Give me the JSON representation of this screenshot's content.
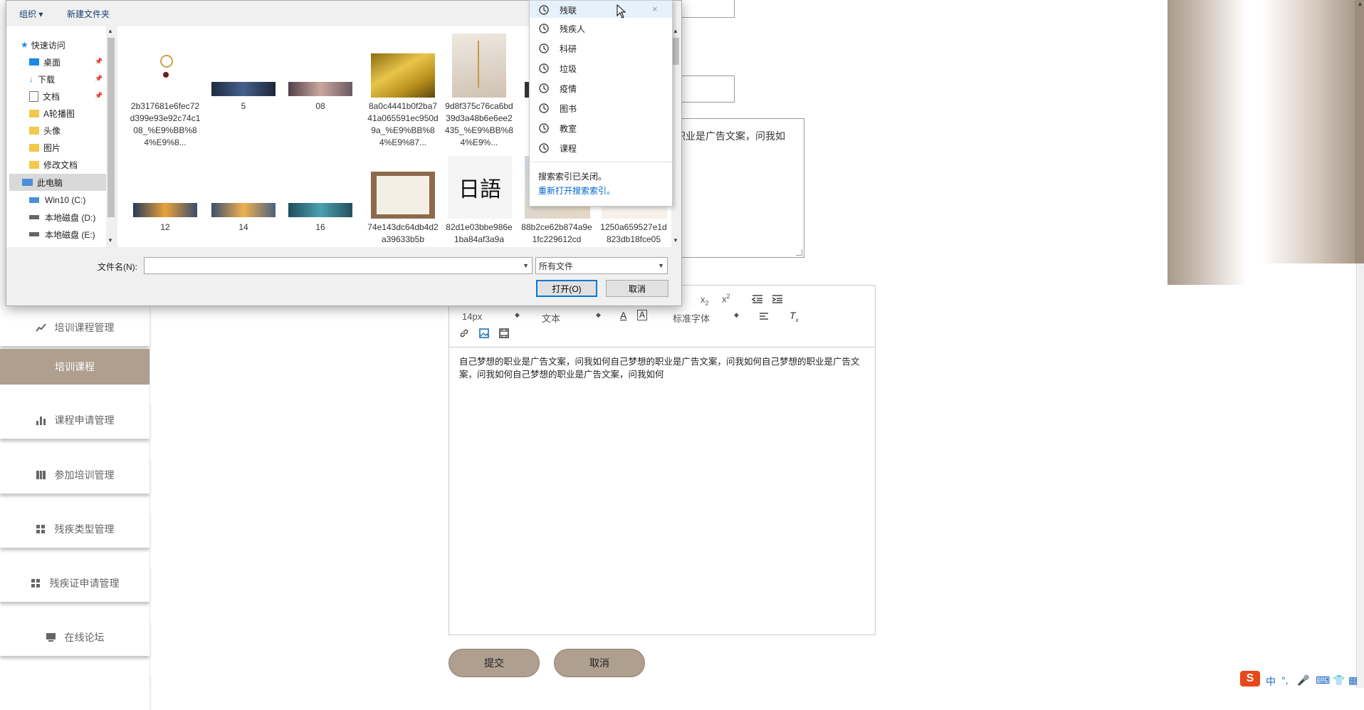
{
  "sidebar": {
    "items": [
      {
        "label": "培训课程管理",
        "icon": "line-chart-icon"
      },
      {
        "label": "培训课程",
        "active": true
      },
      {
        "label": "课程申请管理",
        "icon": "bar-chart-icon"
      },
      {
        "label": "参加培训管理",
        "icon": "book-icon"
      },
      {
        "label": "残疾类型管理",
        "icon": "grid-icon"
      },
      {
        "label": "残疾证申请管理",
        "icon": "grid-icon"
      },
      {
        "label": "在线论坛",
        "icon": "monitor-icon"
      }
    ]
  },
  "form": {
    "textarea_text": "职业是广告文案，问我如",
    "editor": {
      "font_size": "14px",
      "format": "文本",
      "font_family": "标准字体",
      "content": "自己梦想的职业是广告文案，问我如何自己梦想的职业是广告文案，问我如何自己梦想的职业是广告文案，问我如何自己梦想的职业是广告文案，问我如何"
    },
    "submit_label": "提交",
    "cancel_label": "取消"
  },
  "dialog": {
    "toolbar": {
      "organize": "组织 ▾",
      "new_folder": "新建文件夹"
    },
    "nav": {
      "quick_access": "快速访问",
      "items": [
        "桌面",
        "下载",
        "文档",
        "A轮播图",
        "头像",
        "图片",
        "修改文档"
      ],
      "this_pc": "此电脑",
      "drives": [
        "Win10 (C:)",
        "本地磁盘 (D:)",
        "本地磁盘 (E:)"
      ]
    },
    "files_row1": [
      "2b317681e6fec72d399e93e92c74c108_%E9%BB%84%E9%8...",
      "5",
      "08",
      "8a0c4441b0f2ba741a065591ec950d9a_%E9%BB%84%E9%87...",
      "9d8f375c76ca6bd39d3a48b6e6ee2435_%E9%BB%84%E9%..."
    ],
    "files_row2": [
      "12",
      "14",
      "16",
      "74e143dc64db4d2a39633b5b",
      "82d1e03bbe986e1ba84af3a9a",
      "88b2ce62b874a9e1fc229612cd",
      "1250a659527e1d823db18fce05"
    ],
    "japanese_thumb_text": "日語",
    "search_history": [
      "残联",
      "残疾人",
      "科研",
      "垃圾",
      "疫情",
      "图书",
      "教室",
      "课程"
    ],
    "index_closed": "搜索索引已关闭。",
    "reopen_index": "重新打开搜索索引。",
    "filename_label": "文件名(N):",
    "filename_value": "",
    "filetype": "所有文件",
    "open_label": "打开(O)",
    "cancel_label": "取消"
  },
  "taskbar": {
    "ime": "中"
  },
  "colors": {
    "accent": "#ae9f8f",
    "link": "#0066cc"
  }
}
